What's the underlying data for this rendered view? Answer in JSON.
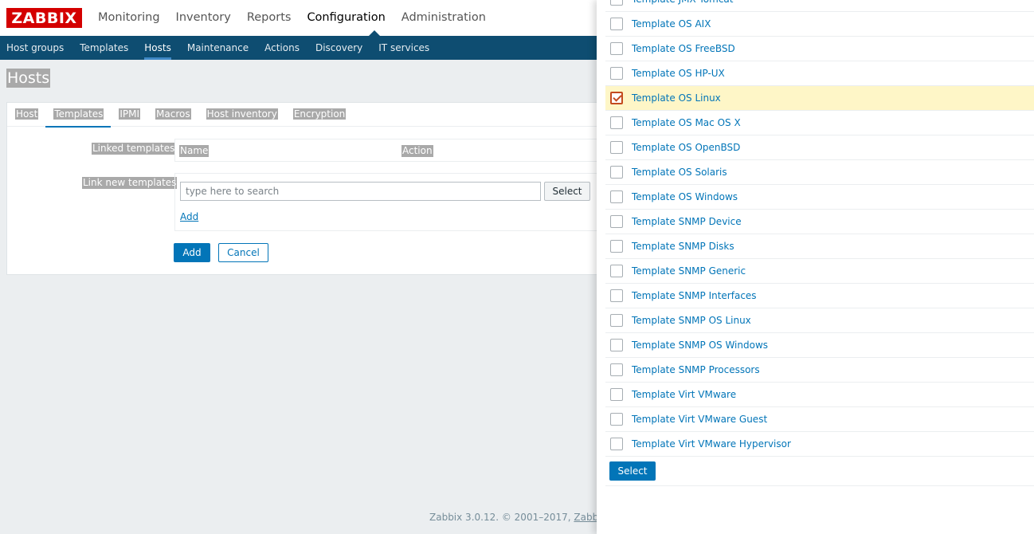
{
  "header": {
    "logo": "ZABBIX",
    "nav": [
      "Monitoring",
      "Inventory",
      "Reports",
      "Configuration",
      "Administration"
    ],
    "active_nav": "Configuration"
  },
  "subnav": {
    "items": [
      "Host groups",
      "Templates",
      "Hosts",
      "Maintenance",
      "Actions",
      "Discovery",
      "IT services"
    ],
    "active": "Hosts"
  },
  "page": {
    "title": "Hosts"
  },
  "form": {
    "tabs": [
      "Host",
      "Templates",
      "IPMI",
      "Macros",
      "Host inventory",
      "Encryption"
    ],
    "active_tab": "Templates",
    "linked_templates_label": "Linked templates",
    "col_name": "Name",
    "col_action": "Action",
    "link_new_label": "Link new templates",
    "search_placeholder": "type here to search",
    "select_button": "Select",
    "add_link": "Add",
    "add_button": "Add",
    "cancel_button": "Cancel"
  },
  "footer": {
    "text": "Zabbix 3.0.12. © 2001–2017, ",
    "link": "Zabbix SIA"
  },
  "overlay": {
    "templates": [
      {
        "name": "Template JMX Tomcat",
        "checked": false
      },
      {
        "name": "Template OS AIX",
        "checked": false
      },
      {
        "name": "Template OS FreeBSD",
        "checked": false
      },
      {
        "name": "Template OS HP-UX",
        "checked": false
      },
      {
        "name": "Template OS Linux",
        "checked": true
      },
      {
        "name": "Template OS Mac OS X",
        "checked": false
      },
      {
        "name": "Template OS OpenBSD",
        "checked": false
      },
      {
        "name": "Template OS Solaris",
        "checked": false
      },
      {
        "name": "Template OS Windows",
        "checked": false
      },
      {
        "name": "Template SNMP Device",
        "checked": false
      },
      {
        "name": "Template SNMP Disks",
        "checked": false
      },
      {
        "name": "Template SNMP Generic",
        "checked": false
      },
      {
        "name": "Template SNMP Interfaces",
        "checked": false
      },
      {
        "name": "Template SNMP OS Linux",
        "checked": false
      },
      {
        "name": "Template SNMP OS Windows",
        "checked": false
      },
      {
        "name": "Template SNMP Processors",
        "checked": false
      },
      {
        "name": "Template Virt VMware",
        "checked": false
      },
      {
        "name": "Template Virt VMware Guest",
        "checked": false
      },
      {
        "name": "Template Virt VMware Hypervisor",
        "checked": false
      }
    ],
    "select_button": "Select"
  }
}
